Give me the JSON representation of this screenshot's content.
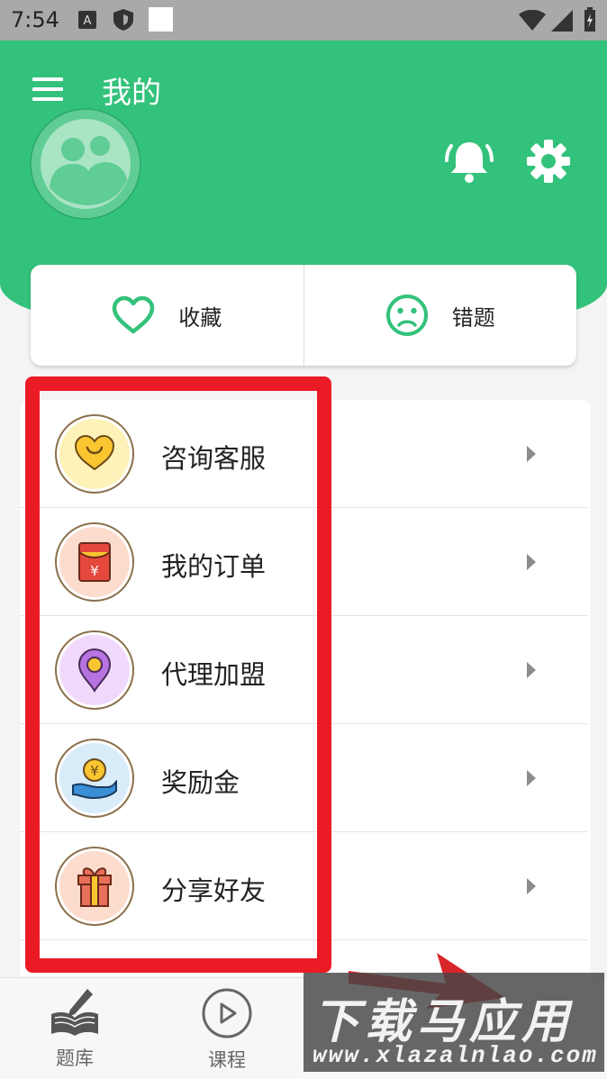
{
  "status_bar": {
    "time": "7:54"
  },
  "header": {
    "title": "我的"
  },
  "quick_actions": [
    {
      "label": "收藏",
      "icon": "heart-icon"
    },
    {
      "label": "错题",
      "icon": "sad-face-icon"
    }
  ],
  "menu": [
    {
      "label": "咨询客服",
      "icon": "heart-chat-icon",
      "color": "#f9c531"
    },
    {
      "label": "我的订单",
      "icon": "red-envelope-icon",
      "color": "#e5483d"
    },
    {
      "label": "代理加盟",
      "icon": "location-pin-icon",
      "color": "#b774e0"
    },
    {
      "label": "奖励金",
      "icon": "coin-hand-icon",
      "color": "#3a8fd6"
    },
    {
      "label": "分享好友",
      "icon": "gift-icon",
      "color": "#e8705a"
    }
  ],
  "bottom_nav": [
    {
      "label": "题库",
      "icon": "book-pen-icon"
    },
    {
      "label": "课程",
      "icon": "play-circle-icon"
    }
  ],
  "watermark": {
    "logo": "下载马应用",
    "url": "www.xlazalnlao.com"
  },
  "colors": {
    "primary": "#33c27b",
    "highlight": "#eb1b26"
  }
}
